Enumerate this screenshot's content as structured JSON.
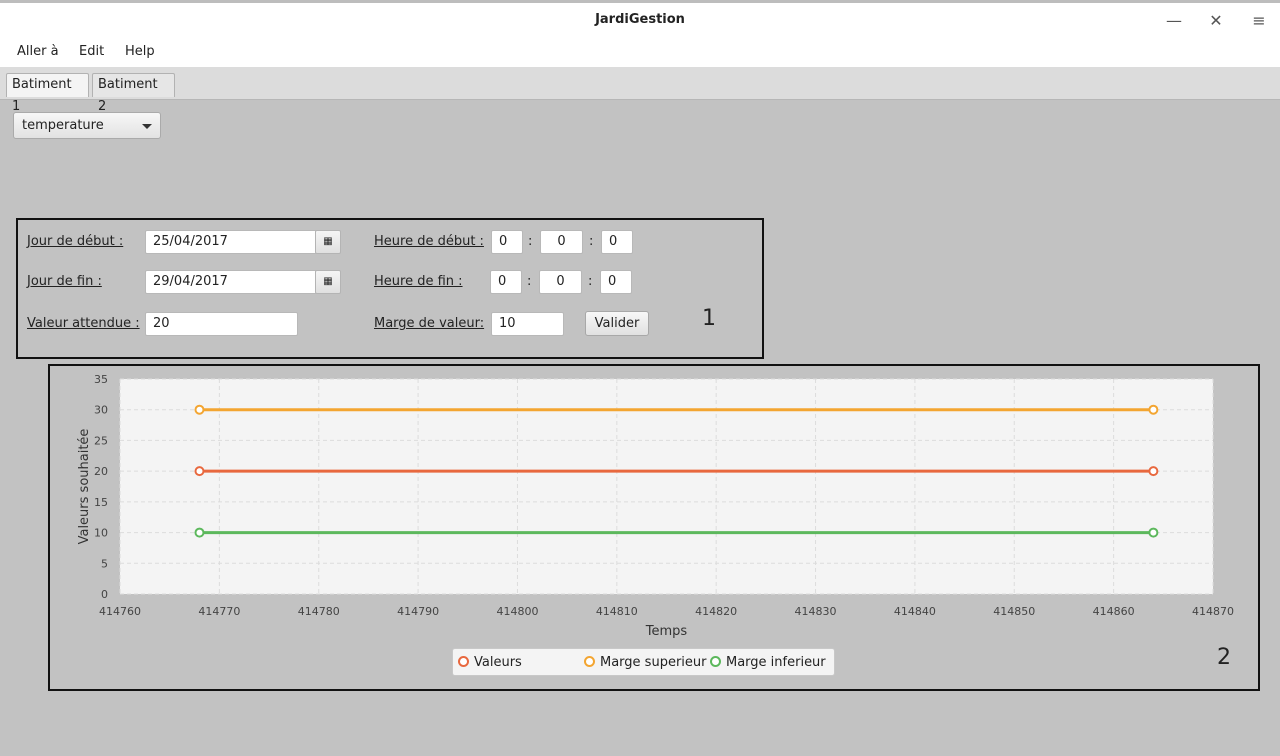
{
  "window": {
    "title": "JardiGestion"
  },
  "menu": [
    "Aller à",
    "Edit",
    "Help"
  ],
  "tabs": [
    "Batiment 1",
    "Batiment 2"
  ],
  "sensor_select": {
    "value": "temperature"
  },
  "form": {
    "start_day_label": "Jour de début :",
    "start_day_value": "25/04/2017",
    "end_day_label": "Jour de fin :",
    "end_day_value": "29/04/2017",
    "expected_label": "Valeur attendue :",
    "expected_value": "20",
    "start_time_label": "Heure de début :",
    "start_time": [
      "0",
      "0",
      "0"
    ],
    "end_time_label": "Heure de fin :",
    "end_time": [
      "0",
      "0",
      "0"
    ],
    "margin_label": "Marge de valeur:",
    "margin_value": "10",
    "submit_label": "Valider",
    "colon": ":"
  },
  "annotations": {
    "box1": "1",
    "box2": "2"
  },
  "icons": {
    "calendar": "calendar-icon",
    "minimize": "minimize-icon",
    "close": "close-icon",
    "menu": "hamburger-menu-icon",
    "dropdown": "chevron-down-icon"
  },
  "chart_data": {
    "type": "line",
    "xlabel": "Temps",
    "ylabel": "Valeurs souhaitée",
    "xlim": [
      414760,
      414870
    ],
    "ylim": [
      0,
      35
    ],
    "x_ticks": [
      414760,
      414770,
      414780,
      414790,
      414800,
      414810,
      414820,
      414830,
      414840,
      414850,
      414860,
      414870
    ],
    "y_ticks": [
      0,
      5,
      10,
      15,
      20,
      25,
      30,
      35
    ],
    "grid": true,
    "legend_position": "bottom-center",
    "series": [
      {
        "name": "Valeurs",
        "color": "#e8683e",
        "x": [
          414768,
          414864
        ],
        "y": [
          20,
          20
        ]
      },
      {
        "name": "Marge superieur",
        "color": "#f3a531",
        "x": [
          414768,
          414864
        ],
        "y": [
          30,
          30
        ]
      },
      {
        "name": "Marge inferieur",
        "color": "#5cb85c",
        "x": [
          414768,
          414864
        ],
        "y": [
          10,
          10
        ]
      }
    ]
  }
}
